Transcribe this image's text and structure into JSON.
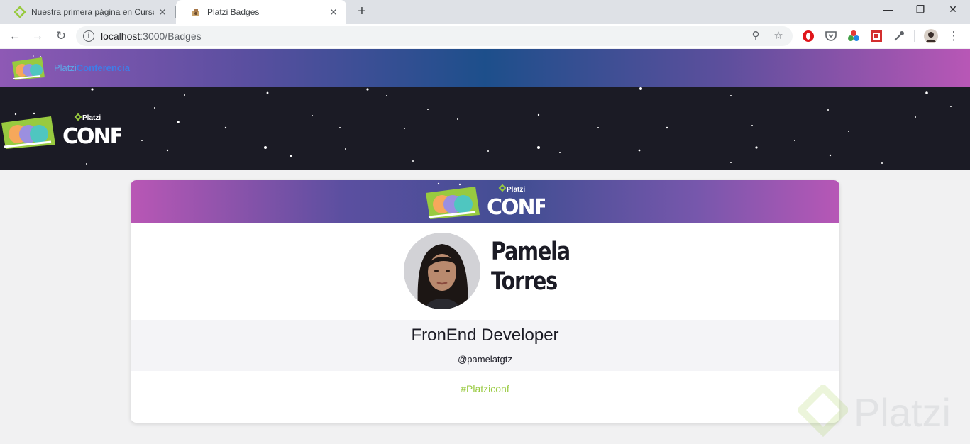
{
  "browser": {
    "tabs": [
      {
        "title": "Nuestra primera página en Curso",
        "active": false,
        "favicon": "platzi-icon"
      },
      {
        "title": "Platzi Badges",
        "active": true,
        "favicon": "badge-icon"
      }
    ],
    "new_tab_label": "+",
    "window_controls": {
      "minimize": "—",
      "maximize": "❐",
      "close": "✕"
    },
    "url_host": "localhost",
    "url_path": ":3000/Badges"
  },
  "navbar": {
    "brand_light": "Platzi",
    "brand_bold": "Conferencia"
  },
  "hero": {
    "logo_text_small": "Platzi",
    "logo_text_large": "CONF"
  },
  "badge": {
    "header_logo_small": "Platzi",
    "header_logo_large": "CONF",
    "first_name": "Pamela",
    "last_name": "Torres",
    "job_title": "FronEnd Developer",
    "handle": "@pamelatgtz",
    "hashtag": "#Platziconf"
  },
  "watermark": {
    "text": "Platzi"
  },
  "colors": {
    "nav_gradient_center": "#1d4f8b",
    "nav_gradient_edge": "#b857b6",
    "hero_bg": "#1b1b25",
    "hashtag": "#98ca3f",
    "page_bg": "#f1f1f2"
  }
}
